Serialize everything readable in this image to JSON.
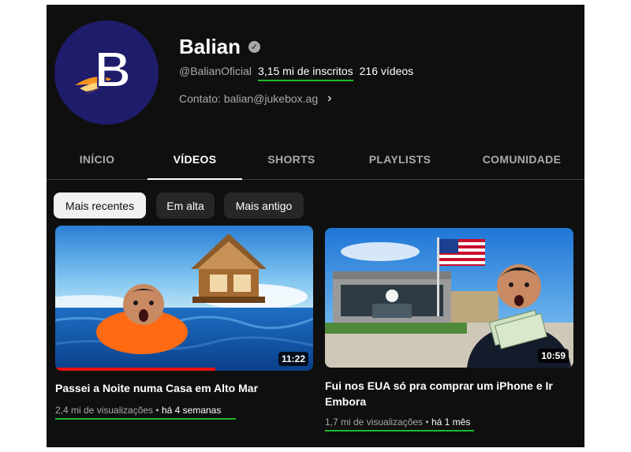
{
  "channel": {
    "name": "Balian",
    "avatar_letter": "B",
    "handle": "@BalianOficial",
    "subscribers": "3,15 mi de inscritos",
    "videos_count": "216 vídeos",
    "contact": "Contato: balian@jukebox.ag",
    "verified_icon": "check-circle-icon"
  },
  "tabs": [
    {
      "label": "INÍCIO",
      "active": false
    },
    {
      "label": "VÍDEOS",
      "active": true
    },
    {
      "label": "SHORTS",
      "active": false
    },
    {
      "label": "PLAYLISTS",
      "active": false
    },
    {
      "label": "COMUNIDADE",
      "active": false
    }
  ],
  "filters": [
    {
      "label": "Mais recentes",
      "selected": true
    },
    {
      "label": "Em alta",
      "selected": false
    },
    {
      "label": "Mais antigo",
      "selected": false
    }
  ],
  "videos": [
    {
      "title": "Passei a Noite numa Casa em Alto Mar",
      "views": "2,4 mi de visualizações",
      "age": "há 4 semanas",
      "duration": "11:22",
      "watched_fraction": 0.62
    },
    {
      "title": "Fui nos EUA só pra comprar um iPhone e Ir Embora",
      "views": "1,7 mi de visualizações",
      "age": "há 1 mês",
      "duration": "10:59",
      "watched_fraction": 0
    }
  ],
  "colors": {
    "background": "#0f0f0f",
    "accent_underline": "#1fb82a",
    "progress": "#ee1111",
    "avatar_bg": "#1f1c6b",
    "avatar_flame": "#f7941d"
  }
}
